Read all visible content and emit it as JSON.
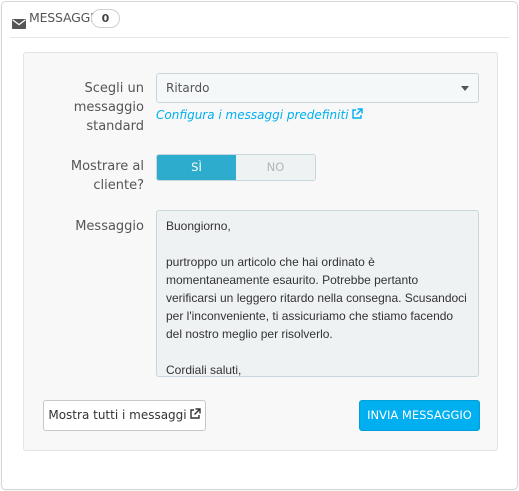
{
  "panel": {
    "title": "MESSAGGI",
    "count": "0"
  },
  "form": {
    "standard_label": "Scegli un messaggio standard",
    "standard_selected": "Ritardo",
    "config_link": "Configura i messaggi predefiniti",
    "show_label": "Mostrare al cliente?",
    "toggle": {
      "yes": "SÌ",
      "no": "NO",
      "selected": "SÌ"
    },
    "message_label": "Messaggio",
    "message_paragraphs": [
      "Buongiorno,",
      "purtroppo un articolo che hai ordinato è momentaneamente esaurito. Potrebbe pertanto verificarsi un leggero ritardo nella consegna. Scusandoci per l'inconveniente, ti assicuriamo che stiamo facendo del nostro meglio per risolverlo.",
      "Cordiali saluti,"
    ],
    "show_all_button": "Mostra tutti i messaggi",
    "send_button": "INVIA MESSAGGIO"
  },
  "icons": {
    "heading": "envelope-icon",
    "external": "external-link-icon",
    "caret": "caret-down-icon"
  },
  "colors": {
    "accent": "#00aff0",
    "toggle_active": "#2eacce",
    "field_bg": "#eef2f3"
  }
}
